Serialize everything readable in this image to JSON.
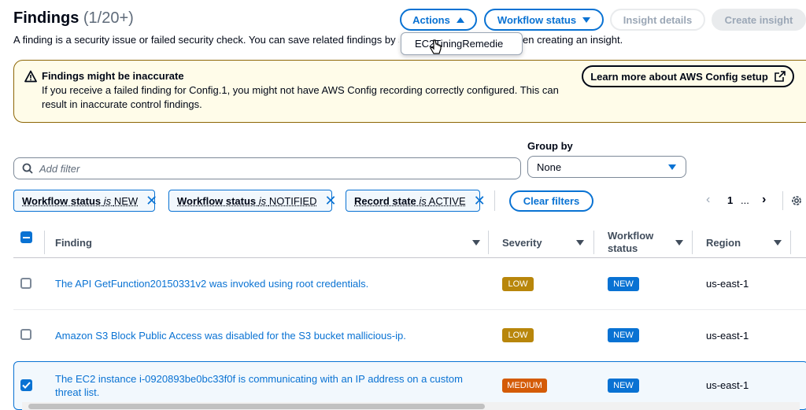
{
  "header": {
    "title": "Findings",
    "count": "(1/20+)",
    "description": "A finding is a security issue or failed security check. You can save related findings by sel",
    "description_tail": "en creating an insight."
  },
  "toolbar": {
    "actions_label": "Actions",
    "workflow_status_label": "Workflow status",
    "insight_details_label": "Insight details",
    "create_insight_label": "Create insight"
  },
  "actions_menu": {
    "items": [
      "EC2TiningRemedie"
    ]
  },
  "alert": {
    "title": "Findings might be inaccurate",
    "body": "If you receive a failed finding for Config.1, you might not have AWS Config recording correctly configured. This can result in inaccurate control findings.",
    "button_label": "Learn more about AWS Config setup"
  },
  "filters": {
    "placeholder": "Add filter",
    "group_by_label": "Group by",
    "group_by_value": "None",
    "tokens": [
      {
        "field": "Workflow status",
        "op": "is",
        "value": "NEW"
      },
      {
        "field": "Workflow status",
        "op": "is",
        "value": "NOTIFIED"
      },
      {
        "field": "Record state",
        "op": "is",
        "value": "ACTIVE"
      }
    ],
    "clear_label": "Clear filters"
  },
  "pagination": {
    "current": "1",
    "ellipsis": "..."
  },
  "table": {
    "columns": [
      "Finding",
      "Severity",
      "Workflow status",
      "Region"
    ],
    "rows": [
      {
        "finding": "The API GetFunction20150331v2 was invoked using root credentials.",
        "severity": "LOW",
        "workflow": "NEW",
        "region": "us-east-1",
        "selected": false
      },
      {
        "finding": "Amazon S3 Block Public Access was disabled for the S3 bucket mallicious-ip.",
        "severity": "LOW",
        "workflow": "NEW",
        "region": "us-east-1",
        "selected": false
      },
      {
        "finding_line1": "The EC2 instance i-0920893be0bc33f0f is communicating with an IP address on a custom",
        "finding_line2": "threat list.",
        "severity": "MEDIUM",
        "workflow": "NEW",
        "region": "us-east-1",
        "selected": true
      }
    ]
  },
  "colors": {
    "primary": "#0972d3",
    "low_badge": "#b8860b",
    "medium_badge": "#d45b07",
    "alert_bg": "#fffce9",
    "alert_border": "#8d6605"
  }
}
